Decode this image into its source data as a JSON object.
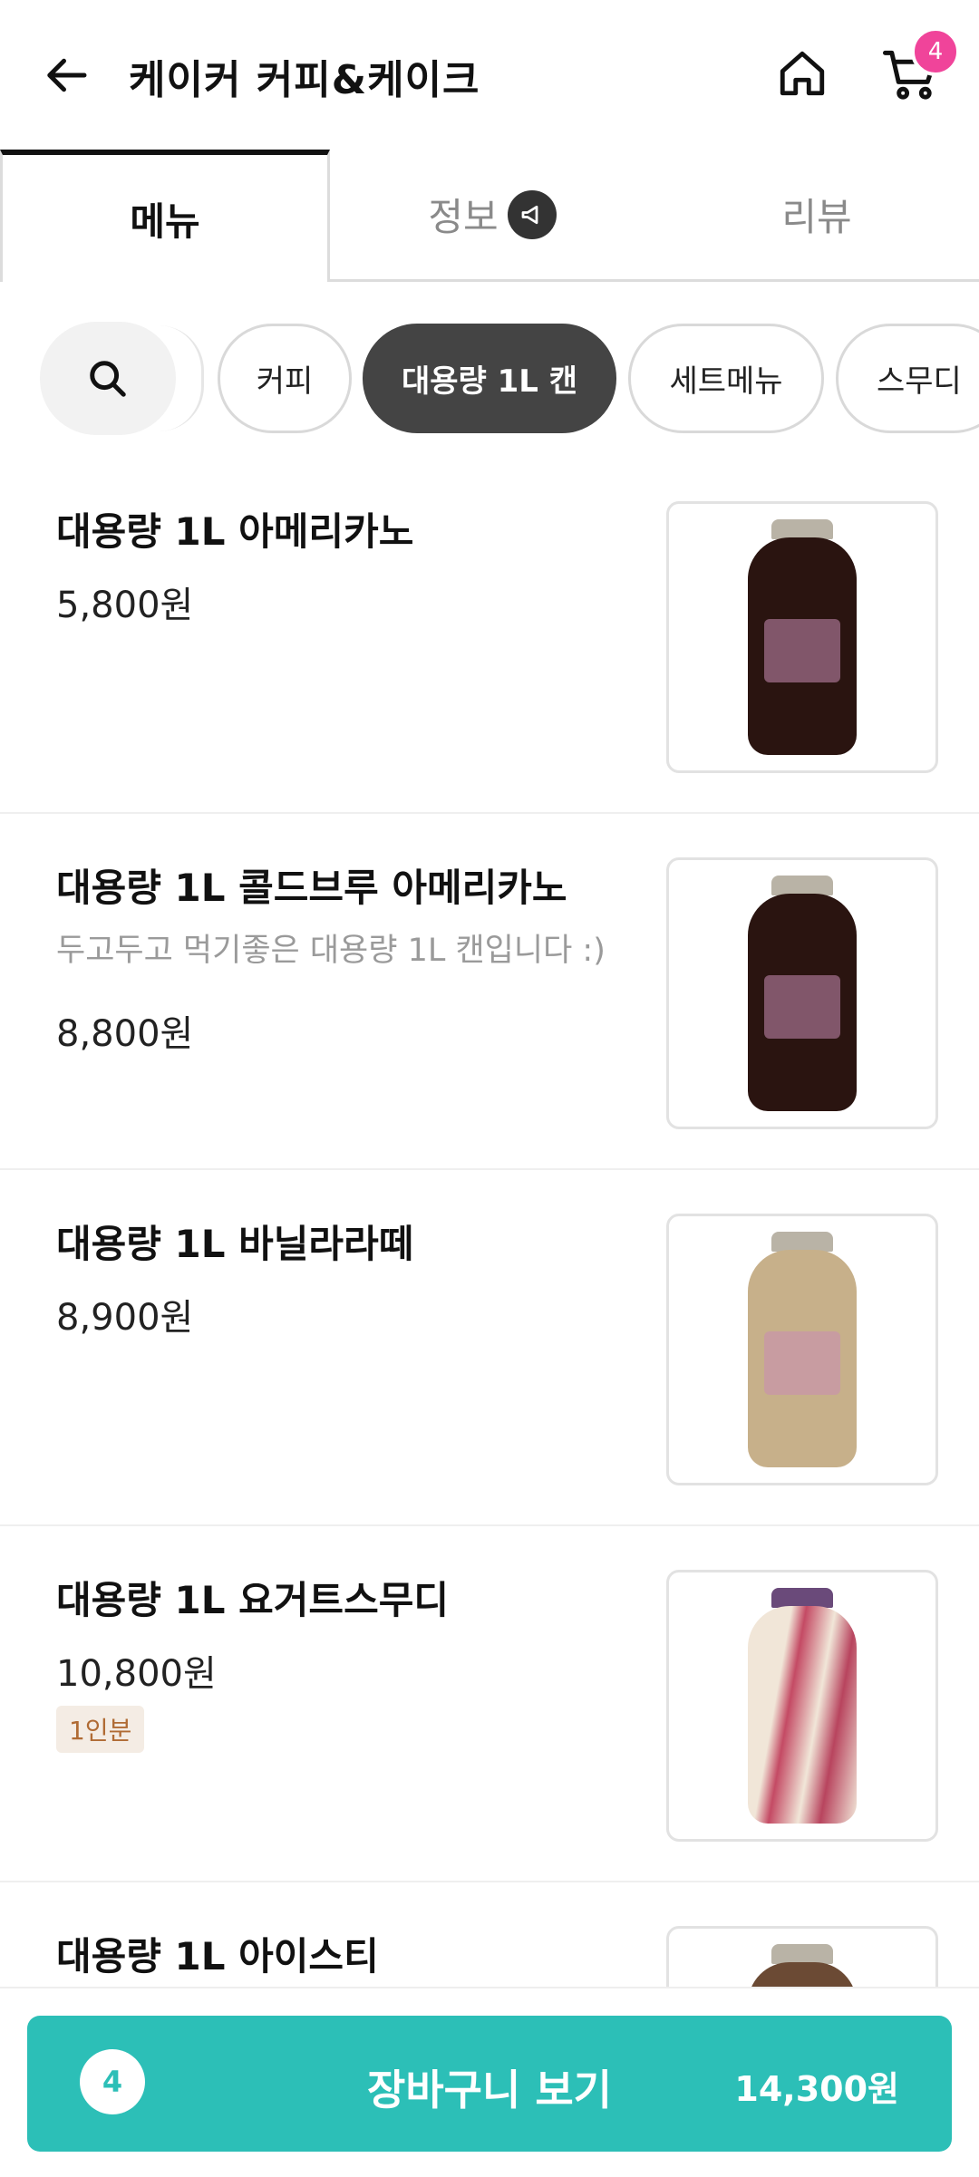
{
  "header": {
    "title": "케이커 커피&케이크",
    "cart_badge": "4"
  },
  "tabs": [
    {
      "label": "메뉴",
      "active": true
    },
    {
      "label": "정보",
      "active": false
    },
    {
      "label": "리뷰",
      "active": false
    }
  ],
  "categories": [
    {
      "label": "커피"
    },
    {
      "label": "대용량 1L 캔",
      "selected": true
    },
    {
      "label": "세트메뉴"
    },
    {
      "label": "스무디"
    }
  ],
  "menu": [
    {
      "name": "대용량 1L 아메리카노",
      "desc": "",
      "price": "5,800원",
      "tag": "",
      "liquid": "#2a1410"
    },
    {
      "name": "대용량 1L 콜드브루 아메리카노",
      "desc": "두고두고 먹기좋은 대용량 1L 캔입니다 :)",
      "price": "8,800원",
      "tag": "",
      "liquid": "#2a1410"
    },
    {
      "name": "대용량 1L 바닐라라떼",
      "desc": "",
      "price": "8,900원",
      "tag": "",
      "liquid": "#c7b08a"
    },
    {
      "name": "대용량 1L 요거트스무디",
      "desc": "",
      "price": "10,800원",
      "tag": "1인분",
      "liquid": "#c44a64"
    },
    {
      "name": "대용량 1L 아이스티",
      "desc": "",
      "price": "",
      "tag": "",
      "liquid": "#6b4a34"
    }
  ],
  "cart": {
    "count": "4",
    "label": "장바구니 보기",
    "total": "14,300원"
  },
  "colors": {
    "accent": "#2cbfb7",
    "badge": "#f0449a",
    "chip_selected": "#444444"
  }
}
